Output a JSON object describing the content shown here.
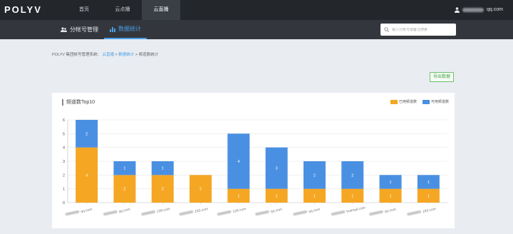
{
  "app": {
    "logo": "POLYV"
  },
  "topnav": {
    "items": [
      {
        "label": "首页",
        "active": false
      },
      {
        "label": "云点播",
        "active": false
      },
      {
        "label": "云直播",
        "active": true
      }
    ]
  },
  "user": {
    "email_suffix": "qq.com"
  },
  "subnav": {
    "items": [
      {
        "label": "分帐号管理",
        "icon": "accounts-icon",
        "active": false
      },
      {
        "label": "数据统计",
        "icon": "bar-chart-icon",
        "active": true
      }
    ]
  },
  "search": {
    "placeholder": "输入分帐号或备注搜索"
  },
  "breadcrumb": {
    "root": "POLYV 集团帐号管理系统：",
    "level1": "云直播",
    "sep": " > ",
    "level2": "数据统计",
    "current": "频道数统计"
  },
  "toolbar": {
    "export_label": "导出数据"
  },
  "colors": {
    "used": "#f5a623",
    "available": "#4a90e2",
    "accent": "#4a9fe8"
  },
  "chart_data": {
    "type": "bar",
    "stacked": true,
    "title": "频道数Top10",
    "categories": [
      "qq.com",
      "qq.com",
      "139.com",
      "163.com",
      "126.com",
      "qq.com",
      "qq.com",
      "hotmail.com",
      "qq.com",
      "163.com"
    ],
    "series": [
      {
        "name": "已用频道数",
        "values": [
          4,
          2,
          2,
          2,
          1,
          1,
          1,
          1,
          1,
          1
        ]
      },
      {
        "name": "可用频道数",
        "values": [
          2,
          1,
          1,
          0,
          4,
          3,
          2,
          2,
          1,
          1
        ]
      }
    ],
    "ylim": [
      0,
      6
    ],
    "yticks": [
      "0",
      "1",
      "2",
      "3",
      "4",
      "5",
      "6"
    ],
    "grid": true,
    "legend": "top-right"
  }
}
